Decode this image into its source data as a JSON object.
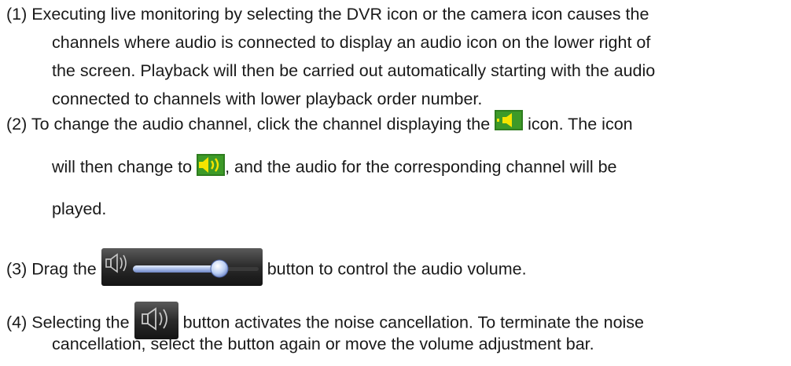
{
  "items": [
    {
      "lines": [
        "(1) Executing live monitoring by selecting the DVR icon or the camera icon causes the",
        "channels where audio is connected to display an audio icon on the lower right of",
        "the screen. Playback will then be carried out automatically starting with the audio",
        "connected to channels with lower playback order number."
      ]
    },
    {
      "line1_before": "(2) To change the audio channel, click the channel displaying the",
      "line1_after": "icon. The icon",
      "line2_before": "will then change to",
      "line2_after": ", and the audio for the corresponding channel will be",
      "line3": "played."
    },
    {
      "before": "(3) Drag the",
      "after": "button to control the audio volume."
    },
    {
      "line1_before": "(4) Selecting the",
      "line1_after": "button activates the noise cancellation. To terminate the noise",
      "line2": "cancellation, select the button again or move the volume adjustment bar."
    }
  ],
  "icons": {
    "audio_icon": "speaker-icon",
    "audio_active_icon": "speaker-playing-icon",
    "volume_bar": "volume-slider",
    "noise_button": "noise-cancel-speaker-icon",
    "yellow": "#f2e600",
    "green": "#2aa62a"
  }
}
